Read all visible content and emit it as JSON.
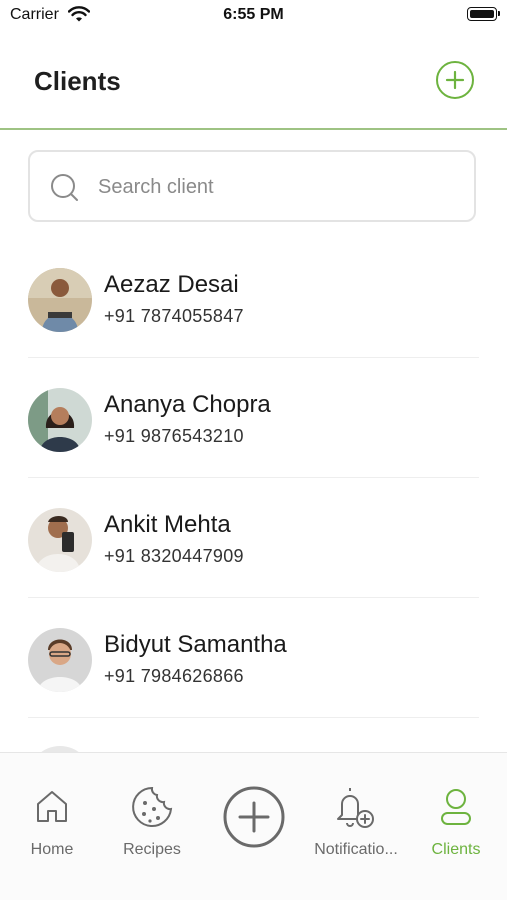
{
  "status_bar": {
    "carrier": "Carrier",
    "time": "6:55 PM"
  },
  "header": {
    "title": "Clients",
    "add_icon": "plus-circle-icon"
  },
  "search": {
    "placeholder": "Search client",
    "value": "",
    "icon": "search-icon"
  },
  "clients": [
    {
      "name": "Aezaz Desai",
      "phone": "+91 7874055847"
    },
    {
      "name": "Ananya Chopra",
      "phone": "+91 9876543210"
    },
    {
      "name": "Ankit Mehta",
      "phone": "+91 8320447909"
    },
    {
      "name": "Bidyut Samantha",
      "phone": "+91 7984626866"
    }
  ],
  "tabs": [
    {
      "label": "Home",
      "icon": "home-icon"
    },
    {
      "label": "Recipes",
      "icon": "cookie-icon"
    },
    {
      "label": "",
      "icon": "plus-circle-icon"
    },
    {
      "label": "Notificatio...",
      "icon": "bell-plus-icon"
    },
    {
      "label": "Clients",
      "icon": "user-icon",
      "active": true
    }
  ],
  "colors": {
    "accent": "#6db33f",
    "divider": "#9ec383",
    "text": "#1f1f1f",
    "muted": "#6a6a6a"
  }
}
